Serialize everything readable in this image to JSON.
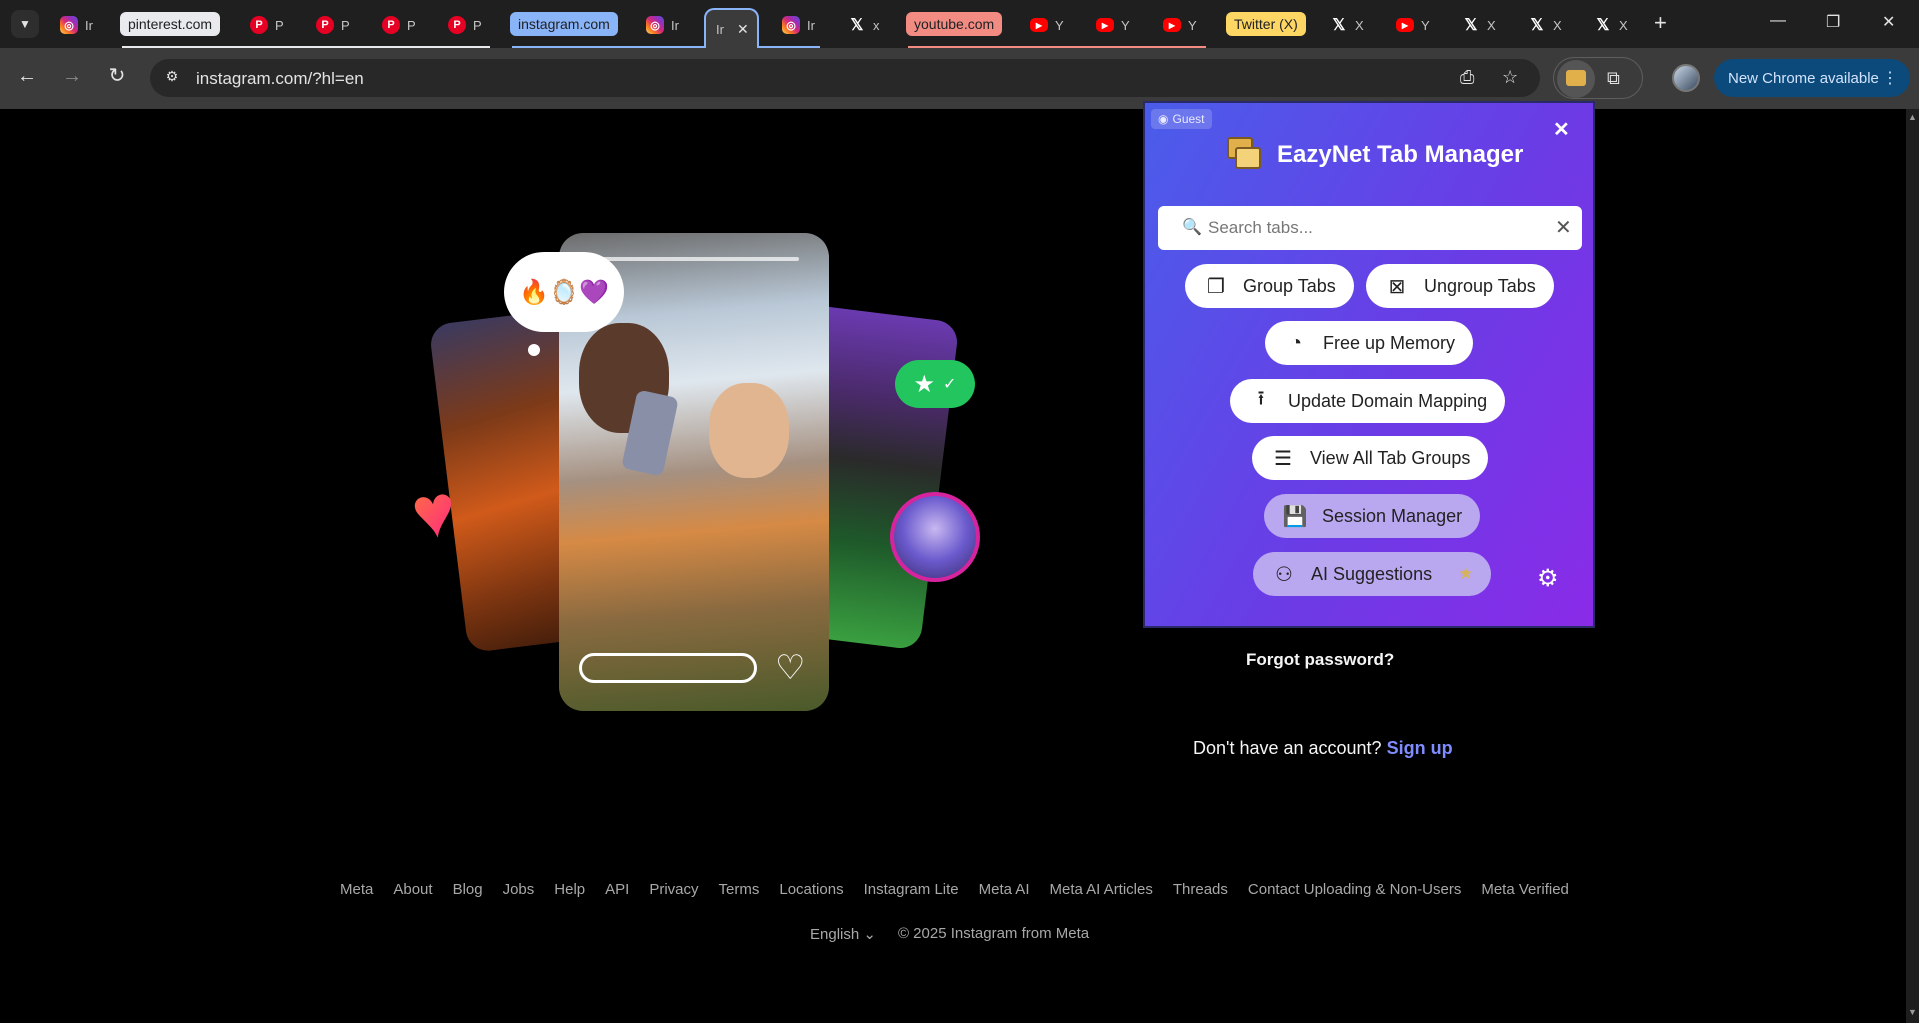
{
  "browser": {
    "tabs": [
      {
        "kind": "icon",
        "icon": "instagram-icon",
        "label": "Ir"
      },
      {
        "kind": "chip",
        "label": "pinterest.com",
        "color": "#e8eaed"
      },
      {
        "kind": "icon",
        "icon": "pinterest-icon",
        "label": "P"
      },
      {
        "kind": "icon",
        "icon": "pinterest-icon",
        "label": "P"
      },
      {
        "kind": "icon",
        "icon": "pinterest-icon",
        "label": "P"
      },
      {
        "kind": "icon",
        "icon": "pinterest-icon",
        "label": "P"
      },
      {
        "kind": "chip",
        "label": "instagram.com",
        "color": "#8ab4f8"
      },
      {
        "kind": "icon",
        "icon": "instagram-icon",
        "label": "Ir"
      },
      {
        "kind": "active",
        "label": "Ir"
      },
      {
        "kind": "icon",
        "icon": "instagram-icon",
        "label": "Ir"
      },
      {
        "kind": "icon",
        "icon": "x-icon",
        "label": "x"
      },
      {
        "kind": "chip",
        "label": "youtube.com",
        "color": "#f28b82"
      },
      {
        "kind": "icon",
        "icon": "youtube-icon",
        "label": "Y"
      },
      {
        "kind": "icon",
        "icon": "youtube-icon",
        "label": "Y"
      },
      {
        "kind": "icon",
        "icon": "youtube-icon",
        "label": "Y"
      },
      {
        "kind": "chip",
        "label": "Twitter (X)",
        "color": "#fdd663"
      },
      {
        "kind": "icon",
        "icon": "x-icon",
        "label": "X"
      },
      {
        "kind": "icon",
        "icon": "youtube-icon",
        "label": "Y"
      },
      {
        "kind": "icon",
        "icon": "x-icon",
        "label": "X"
      },
      {
        "kind": "icon",
        "icon": "x-icon",
        "label": "X"
      },
      {
        "kind": "icon",
        "icon": "x-icon",
        "label": "X"
      }
    ],
    "address": "instagram.com/?hl=en",
    "update_label": "New Chrome available"
  },
  "popup": {
    "guest_label": "Guest",
    "title": "EazyNet Tab Manager",
    "search_placeholder": "Search tabs...",
    "buttons": {
      "group": "Group Tabs",
      "ungroup": "Ungroup Tabs",
      "memory": "Free up Memory",
      "domain": "Update Domain Mapping",
      "view_all": "View All Tab Groups",
      "session": "Session Manager",
      "ai": "AI Suggestions"
    }
  },
  "page": {
    "bubble_emojis": "🔥🪞💜",
    "forgot_password": "Forgot password?",
    "no_account": "Don't have an account?",
    "sign_up": "Sign up",
    "footer_links": [
      "Meta",
      "About",
      "Blog",
      "Jobs",
      "Help",
      "API",
      "Privacy",
      "Terms",
      "Locations",
      "Instagram Lite",
      "Meta AI",
      "Meta AI Articles",
      "Threads",
      "Contact Uploading & Non-Users",
      "Meta Verified"
    ],
    "language": "English",
    "copyright": "© 2025 Instagram from Meta"
  },
  "colors": {
    "accent_blue": "#8ab4f8",
    "popup_gradient_start": "#4a5dea",
    "popup_gradient_end": "#8a2be8",
    "signup_link": "#7f8cff"
  }
}
